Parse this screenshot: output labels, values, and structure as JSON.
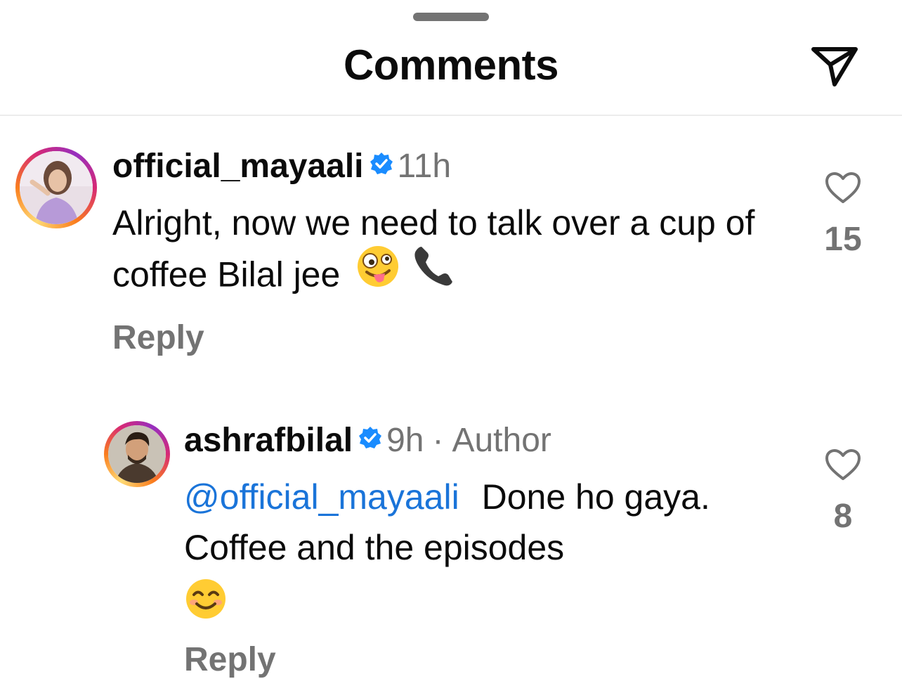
{
  "header": {
    "title": "Comments"
  },
  "comments": [
    {
      "username": "official_mayaali",
      "time": "11h",
      "text": "Alright, now we need to talk over a cup of coffee Bilal jee",
      "emojis": [
        "zany-face-emoji",
        "telephone-receiver-emoji"
      ],
      "likes": "15",
      "reply_label": "Reply"
    },
    {
      "username": "ashrafbilal",
      "time": "9h",
      "separator": "·",
      "role": "Author",
      "mention": "@official_mayaali",
      "text": "Done ho gaya. Coffee and the episodes",
      "emojis": [
        "smiling-face-emoji"
      ],
      "likes": "8",
      "reply_label": "Reply"
    }
  ],
  "colors": {
    "mention": "#1a74d9",
    "muted": "#737373",
    "verified": "#1a8cff"
  }
}
